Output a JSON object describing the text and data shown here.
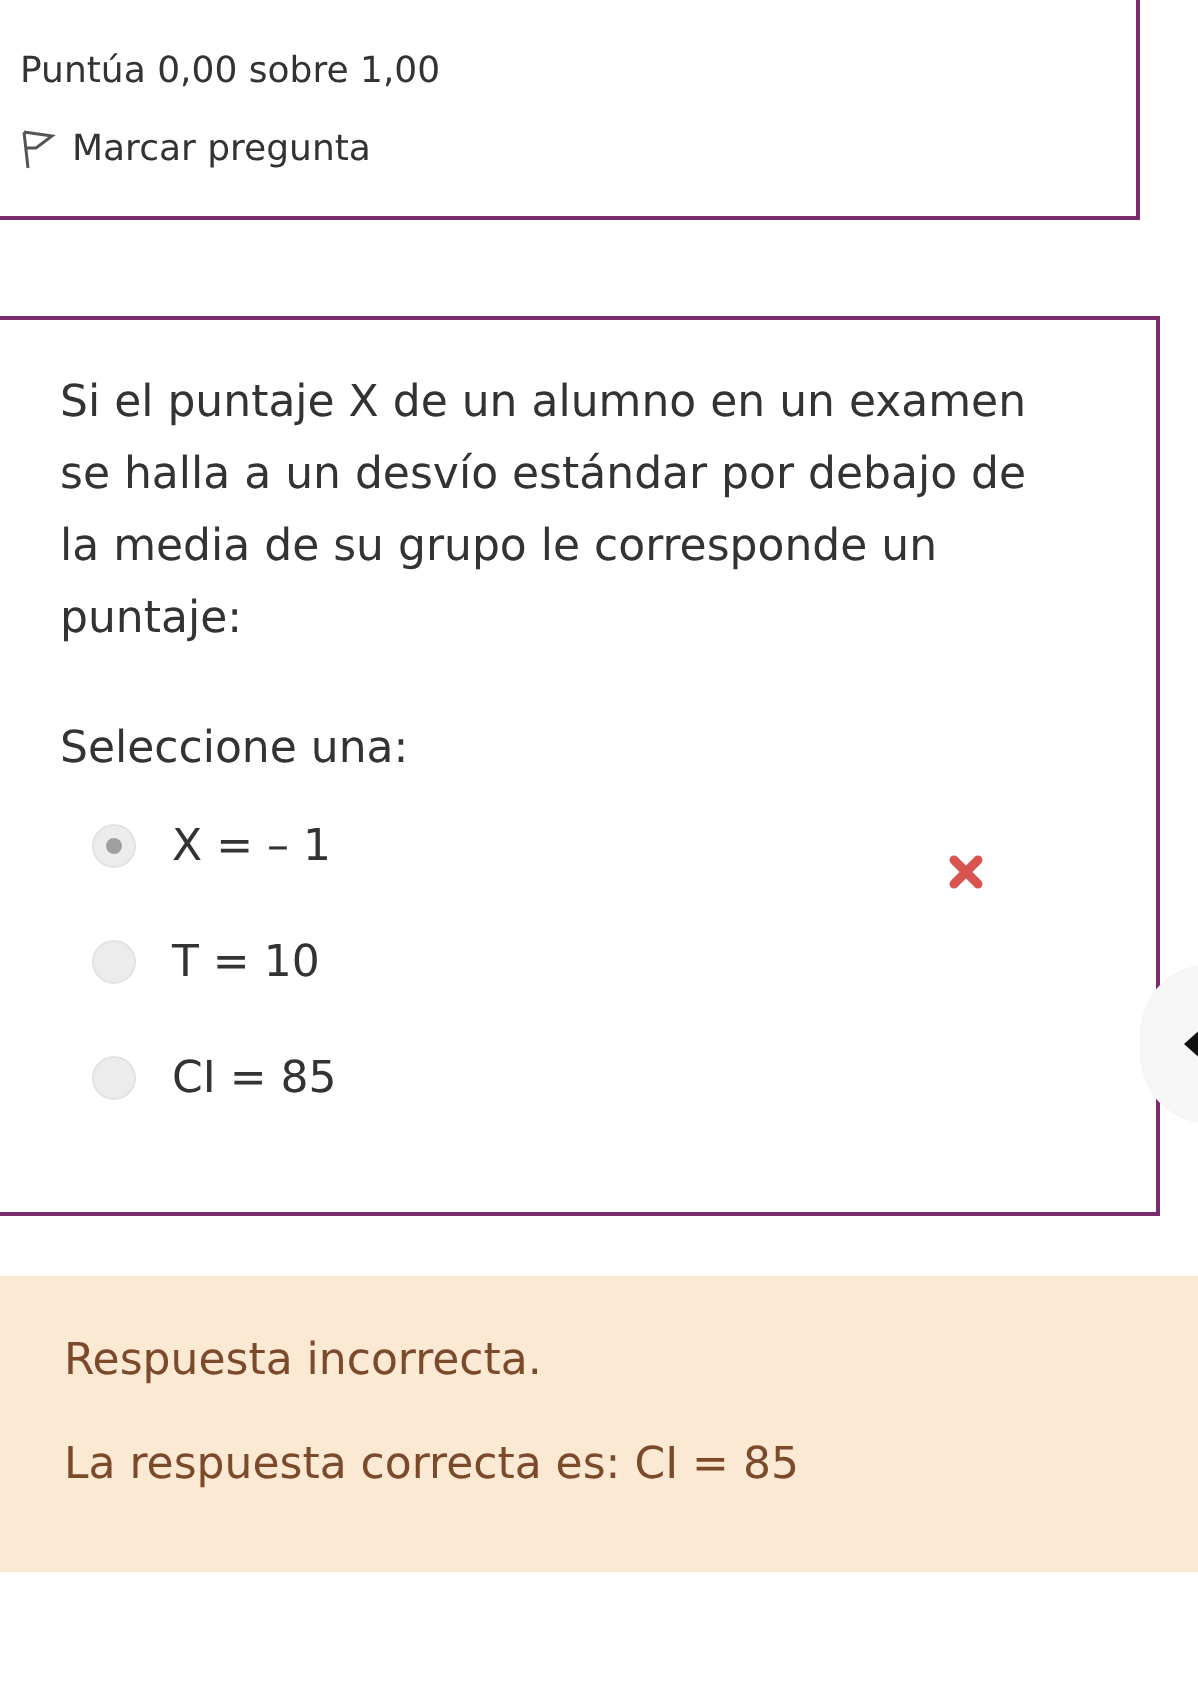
{
  "info": {
    "grade": "Puntúa 0,00 sobre 1,00",
    "flag_label": "Marcar pregunta"
  },
  "question": {
    "text": "Si el puntaje X de un alumno en un examen se halla a un desvío estándar por debajo de la media de su grupo le corresponde un puntaje:",
    "prompt": "Seleccione una:",
    "options": [
      {
        "label": "X = – 1",
        "selected": true,
        "marked_wrong": true
      },
      {
        "label": "T = 10",
        "selected": false,
        "marked_wrong": false
      },
      {
        "label": "CI = 85",
        "selected": false,
        "marked_wrong": false
      }
    ]
  },
  "feedback": {
    "verdict": "Respuesta incorrecta.",
    "correct_answer": "La respuesta correcta es: CI = 85"
  }
}
